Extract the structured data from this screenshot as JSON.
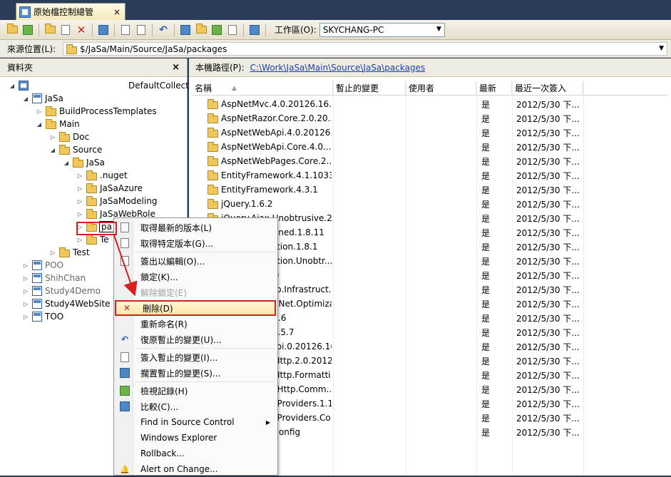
{
  "tab": {
    "title": "原始檔控制總管",
    "close": "×"
  },
  "toolbar": {
    "workspace_label": "工作區(O):",
    "workspace_value": "SKYCHANG-PC"
  },
  "source": {
    "label": "來源位置(L):",
    "path": "$/JaSa/Main/Source/JaSa/packages"
  },
  "folders_pane": {
    "title": "資料夾",
    "close": "×",
    "tree": [
      {
        "label": "DefaultCollect",
        "depth": 0,
        "expander": "◢",
        "icon": "server-icon"
      },
      {
        "label": "JaSa",
        "depth": 1,
        "expander": "◢",
        "icon": "project-icon"
      },
      {
        "label": "BuildProcessTemplates",
        "depth": 2,
        "expander": "▷",
        "icon": "folder-icon"
      },
      {
        "label": "Main",
        "depth": 2,
        "expander": "◢",
        "icon": "folder-icon"
      },
      {
        "label": "Doc",
        "depth": 3,
        "expander": "▷",
        "icon": "folder-icon"
      },
      {
        "label": "Source",
        "depth": 3,
        "expander": "◢",
        "icon": "folder-icon"
      },
      {
        "label": "JaSa",
        "depth": 4,
        "expander": "◢",
        "icon": "folder-icon"
      },
      {
        "label": ".nuget",
        "depth": 5,
        "expander": "▷",
        "icon": "folder-icon"
      },
      {
        "label": "JaSaAzure",
        "depth": 5,
        "expander": "▷",
        "icon": "folder-icon"
      },
      {
        "label": "JaSaModeling",
        "depth": 5,
        "expander": "▷",
        "icon": "folder-icon"
      },
      {
        "label": "JaSaWebRole",
        "depth": 5,
        "expander": "▷",
        "icon": "folder-icon"
      },
      {
        "label": "pa",
        "depth": 5,
        "expander": "▷",
        "icon": "folder-icon",
        "selected": true
      },
      {
        "label": "Te",
        "depth": 5,
        "expander": "▷",
        "icon": "folder-icon"
      },
      {
        "label": "Test",
        "depth": 3,
        "expander": "▷",
        "icon": "folder-icon"
      },
      {
        "label": "POO",
        "depth": 1,
        "expander": "▷",
        "icon": "project-icon",
        "gray": true
      },
      {
        "label": "ShihChan",
        "depth": 1,
        "expander": "▷",
        "icon": "project-icon",
        "gray": true
      },
      {
        "label": "Study4Demo",
        "depth": 1,
        "expander": "▷",
        "icon": "project-icon",
        "gray": true
      },
      {
        "label": "Study4WebSite",
        "depth": 1,
        "expander": "▷",
        "icon": "project-icon"
      },
      {
        "label": "TOO",
        "depth": 1,
        "expander": "▷",
        "icon": "project-icon"
      }
    ]
  },
  "local_path": {
    "label": "本機路徑(P):",
    "value": "C:\\Work\\JaSa\\Main\\Source\\JaSa\\packages"
  },
  "columns": {
    "name": "名稱",
    "pending": "暫止的變更",
    "user": "使用者",
    "latest": "最新",
    "last_checkin": "最近一次簽入"
  },
  "files": [
    {
      "name": "AspNetMvc.4.0.20126.16...",
      "latest": "是",
      "date": "2012/5/30 下..."
    },
    {
      "name": "AspNetRazor.Core.2.0.20...",
      "latest": "是",
      "date": "2012/5/30 下..."
    },
    {
      "name": "AspNetWebApi.4.0.20126...",
      "latest": "是",
      "date": "2012/5/30 下..."
    },
    {
      "name": "AspNetWebApi.Core.4.0....",
      "latest": "是",
      "date": "2012/5/30 下..."
    },
    {
      "name": "AspNetWebPages.Core.2....",
      "latest": "是",
      "date": "2012/5/30 下..."
    },
    {
      "name": "EntityFramework.4.1.1033...",
      "latest": "是",
      "date": "2012/5/30 下..."
    },
    {
      "name": "EntityFramework.4.3.1",
      "latest": "是",
      "date": "2012/5/30 下..."
    },
    {
      "name": "jQuery.1.6.2",
      "latest": "是",
      "date": "2012/5/30 下..."
    },
    {
      "name": "jQuery.Ajax.Unobtrusive.2...",
      "latest": "是",
      "date": "2012/5/30 下..."
    },
    {
      "name": "jQuery.Combined.1.8.11",
      "latest": "是",
      "date": "2012/5/30 下..."
    },
    {
      "name": "jQuery.Validation.1.8.1",
      "latest": "是",
      "date": "2012/5/30 下..."
    },
    {
      "name": "jQuery.Validation.Unobtr...",
      "latest": "是",
      "date": "2012/5/30 下..."
    },
    {
      "name": "Modernizr.2.0",
      "latest": "是",
      "date": "2012/5/30 下..."
    },
    {
      "name": "Microsoft.Web.Infrastruct...",
      "latest": "是",
      "date": "2012/5/30 下..."
    },
    {
      "name": "Microsoft.AspNet.Optimizati...",
      "latest": "是",
      "date": "2012/5/30 下..."
    },
    {
      "name": "WebGrease.1.6",
      "latest": "是",
      "date": "2012/5/30 下..."
    },
    {
      "name": "Newtonsoft.4.5.7",
      "latest": "是",
      "date": "2012/5/30 下..."
    },
    {
      "name": "AspNetWebApi.0.20126.16...",
      "latest": "是",
      "date": "2012/5/30 下..."
    },
    {
      "name": "System.Net.Http.2.0.2012...",
      "latest": "是",
      "date": "2012/5/30 下..."
    },
    {
      "name": "System.Net.Http.Formatti...",
      "latest": "是",
      "date": "2012/5/30 下..."
    },
    {
      "name": "System.Web.Http.Comm...",
      "latest": "是",
      "date": "2012/5/30 下..."
    },
    {
      "name": "System.Web.Providers.1.1",
      "latest": "是",
      "date": "2012/5/30 下..."
    },
    {
      "name": "System.Web.Providers.Co...",
      "latest": "是",
      "date": "2012/5/30 下..."
    },
    {
      "name": "repositories.config",
      "latest": "是",
      "date": "2012/5/30 下..."
    }
  ],
  "context_menu": {
    "items": [
      {
        "label": "取得最新的版本(L)",
        "icon": "get-latest-icon"
      },
      {
        "label": "取得特定版本(G)...",
        "icon": "get-specific-icon"
      },
      {
        "sep": true
      },
      {
        "label": "簽出以編輯(O)...",
        "icon": "checkout-icon"
      },
      {
        "label": "鎖定(K)...",
        "icon": ""
      },
      {
        "label": "解除鎖定(E)",
        "icon": "",
        "disabled": true
      },
      {
        "label": "刪除(D)",
        "icon": "delete-icon",
        "highlight": true
      },
      {
        "label": "重新命名(R)",
        "icon": ""
      },
      {
        "label": "復原暫止的變更(U)...",
        "icon": "undo-icon"
      },
      {
        "sep": true
      },
      {
        "label": "簽入暫止的變更(I)...",
        "icon": "checkin-icon"
      },
      {
        "label": "擱置暫止的變更(S)...",
        "icon": "shelve-icon"
      },
      {
        "sep": true
      },
      {
        "label": "檢視記錄(H)",
        "icon": "history-icon"
      },
      {
        "label": "比較(C)...",
        "icon": "compare-icon"
      },
      {
        "label": "Find in Source Control",
        "icon": "",
        "submenu": true
      },
      {
        "label": "Windows Explorer",
        "icon": ""
      },
      {
        "label": "Rollback...",
        "icon": ""
      },
      {
        "label": "Alert on Change...",
        "icon": "alert-icon"
      }
    ]
  }
}
